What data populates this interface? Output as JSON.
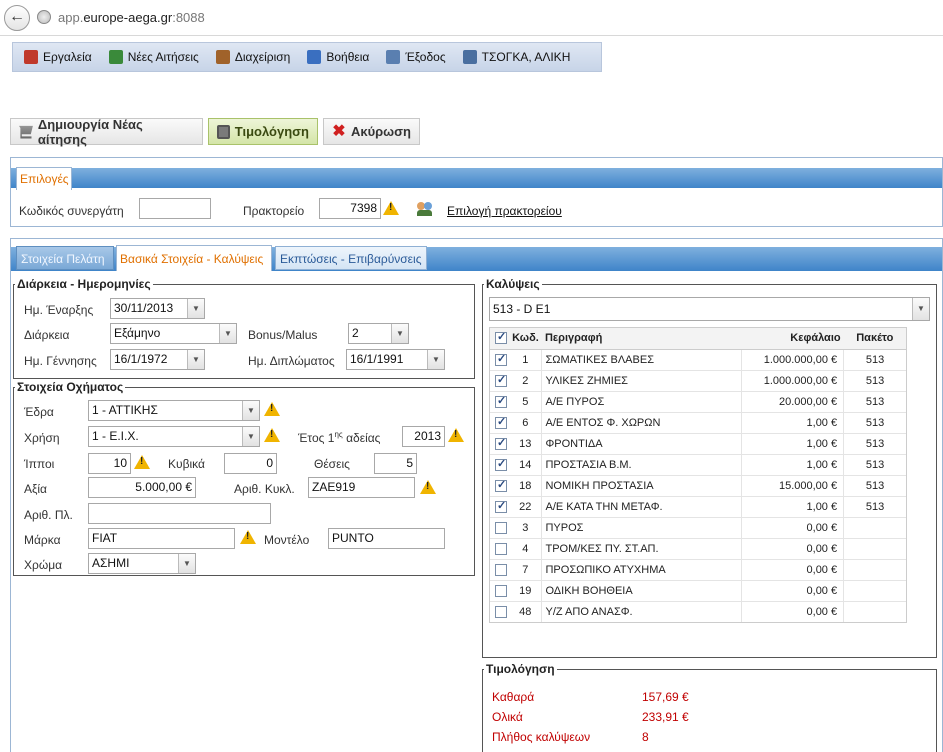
{
  "browser": {
    "url_prefix": "app.",
    "url_domain": "europe-aega.gr",
    "url_port": ":8088"
  },
  "menu": {
    "items": [
      {
        "label": "Εργαλεία",
        "icon": "toolbox-icon",
        "color": "#c0392b"
      },
      {
        "label": "Νέες Αιτήσεις",
        "icon": "new-document-icon",
        "color": "#3a8a3a"
      },
      {
        "label": "Διαχείριση",
        "icon": "briefcase-icon",
        "color": "#a0622a"
      },
      {
        "label": "Βοήθεια",
        "icon": "help-icon",
        "color": "#3a6fc0"
      },
      {
        "label": "Έξοδος",
        "icon": "exit-icon",
        "color": "#5a7fb0"
      },
      {
        "label": "ΤΣΟΓΚΑ, ΑΛΙΚΗ",
        "icon": "user-card-icon",
        "color": "#4a6fa0"
      }
    ]
  },
  "actions": {
    "create_label": "Δημιουργία Νέας αίτησης",
    "invoice_label": "Τιμολόγηση",
    "cancel_label": "Ακύρωση"
  },
  "options": {
    "tab_label": "Επιλογές",
    "partner_code_label": "Κωδικός συνεργάτη",
    "partner_code_value": "",
    "agency_label": "Πρακτορείο",
    "agency_value": "7398",
    "select_agency_link": "Επιλογή πρακτορείου"
  },
  "tabs": [
    {
      "label": "Στοιχεία Πελάτη",
      "state": "inactive"
    },
    {
      "label": "Βασικά Στοιχεία - Καλύψεις",
      "state": "active"
    },
    {
      "label": "Εκπτώσεις - Επιβαρύνσεις",
      "state": "inactive"
    }
  ],
  "duration": {
    "legend": "Διάρκεια - Ημερομηνίες",
    "start_label": "Ημ. Έναρξης",
    "start_value": "30/11/2013",
    "duration_label": "Διάρκεια",
    "duration_value": "Εξάμηνο",
    "bonus_label": "Bonus/Malus",
    "bonus_value": "2",
    "birth_label": "Ημ. Γέννησης",
    "birth_value": "16/1/1972",
    "license_label": "Ημ. Διπλώματος",
    "license_value": "16/1/1991"
  },
  "vehicle": {
    "legend": "Στοιχεία Οχήματος",
    "seat_label": "Έδρα",
    "seat_value": "1 - ΑΤΤΙΚΗΣ",
    "use_label": "Χρήση",
    "use_value": "1 - Ε.Ι.Χ.",
    "first_license_label": "Έτος 1",
    "first_license_sup": "ης",
    "first_license_label2": " αδείας",
    "first_license_value": "2013",
    "hp_label": "Ίπποι",
    "hp_value": "10",
    "cc_label": "Κυβικά",
    "cc_value": "0",
    "seats_label": "Θέσεις",
    "seats_value": "5",
    "value_label": "Αξία",
    "value_value": "5.000,00 €",
    "plate_label": "Αριθ. Κυκλ.",
    "plate_value": "ΖΑΕ919",
    "chassis_label": "Αριθ. Πλ.",
    "chassis_value": "",
    "make_label": "Μάρκα",
    "make_value": "FIAT",
    "model_label": "Μοντέλο",
    "model_value": "PUNTO",
    "color_label": "Χρώμα",
    "color_value": "ΑΣΗΜΙ"
  },
  "coverages": {
    "legend": "Καλύψεις",
    "package_value": "513 - D E1",
    "headers": {
      "code": "Κωδ.",
      "desc": "Περιγραφή",
      "capital": "Κεφάλαιο",
      "package": "Πακέτο"
    },
    "rows": [
      {
        "checked": true,
        "code": "1",
        "desc": "ΣΩΜΑΤΙΚΕΣ ΒΛΑΒΕΣ",
        "capital": "1.000.000,00 €",
        "package": "513"
      },
      {
        "checked": true,
        "code": "2",
        "desc": "ΥΛΙΚΕΣ ΖΗΜΙΕΣ",
        "capital": "1.000.000,00 €",
        "package": "513"
      },
      {
        "checked": true,
        "code": "5",
        "desc": "Α/Ε ΠΥΡΟΣ",
        "capital": "20.000,00 €",
        "package": "513"
      },
      {
        "checked": true,
        "code": "6",
        "desc": "Α/Ε ΕΝΤΟΣ Φ. ΧΩΡΩΝ",
        "capital": "1,00 €",
        "package": "513"
      },
      {
        "checked": true,
        "code": "13",
        "desc": "ΦΡΟΝΤΙΔΑ",
        "capital": "1,00 €",
        "package": "513"
      },
      {
        "checked": true,
        "code": "14",
        "desc": "ΠΡΟΣΤΑΣΙΑ Β.Μ.",
        "capital": "1,00 €",
        "package": "513"
      },
      {
        "checked": true,
        "code": "18",
        "desc": "ΝΟΜΙΚΗ ΠΡΟΣΤΑΣΙΑ",
        "capital": "15.000,00 €",
        "package": "513"
      },
      {
        "checked": true,
        "code": "22",
        "desc": "Α/Ε ΚΑΤΑ ΤΗΝ ΜΕΤΑΦ.",
        "capital": "1,00 €",
        "package": "513"
      },
      {
        "checked": false,
        "code": "3",
        "desc": "ΠΥΡΟΣ",
        "capital": "0,00 €",
        "package": ""
      },
      {
        "checked": false,
        "code": "4",
        "desc": "ΤΡΟΜ/ΚΕΣ ΠΥ. ΣΤ.ΑΠ.",
        "capital": "0,00 €",
        "package": ""
      },
      {
        "checked": false,
        "code": "7",
        "desc": "ΠΡΟΣΩΠΙΚΟ ΑΤΥΧΗΜΑ",
        "capital": "0,00 €",
        "package": ""
      },
      {
        "checked": false,
        "code": "19",
        "desc": "ΟΔΙΚΗ ΒΟΗΘΕΙΑ",
        "capital": "0,00 €",
        "package": ""
      },
      {
        "checked": false,
        "code": "48",
        "desc": "Υ/Ζ ΑΠΟ ΑΝΑΣΦ.",
        "capital": "0,00 €",
        "package": ""
      }
    ]
  },
  "invoice": {
    "legend": "Τιμολόγηση",
    "net_label": "Καθαρά",
    "net_value": "157,69 €",
    "total_label": "Ολικά",
    "total_value": "233,91 €",
    "count_label": "Πλήθος καλύψεων",
    "count_value": "8"
  }
}
